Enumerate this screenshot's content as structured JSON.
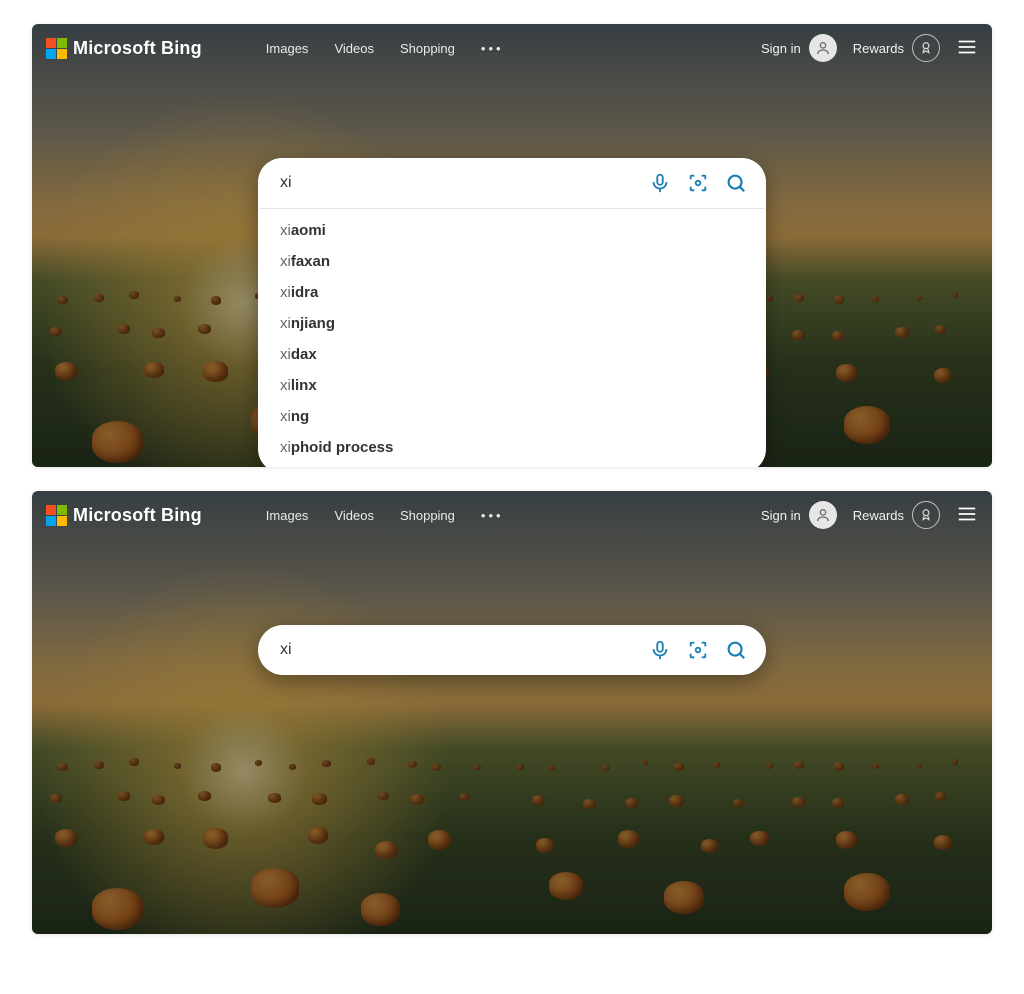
{
  "header": {
    "brand": "Microsoft Bing",
    "nav": {
      "images": "Images",
      "videos": "Videos",
      "shopping": "Shopping",
      "more": "•••"
    },
    "signin": "Sign in",
    "rewards": "Rewards"
  },
  "search1": {
    "query": "xi",
    "suggestions": [
      {
        "prefix": "xi",
        "rest": "aomi"
      },
      {
        "prefix": "xi",
        "rest": "faxan"
      },
      {
        "prefix": "xi",
        "rest": "idra"
      },
      {
        "prefix": "xi",
        "rest": "njiang"
      },
      {
        "prefix": "xi",
        "rest": "dax"
      },
      {
        "prefix": "xi",
        "rest": "linx"
      },
      {
        "prefix": "xi",
        "rest": "ng"
      },
      {
        "prefix": "xi",
        "rest": "phoid process"
      }
    ]
  },
  "search2": {
    "query": "xi "
  }
}
